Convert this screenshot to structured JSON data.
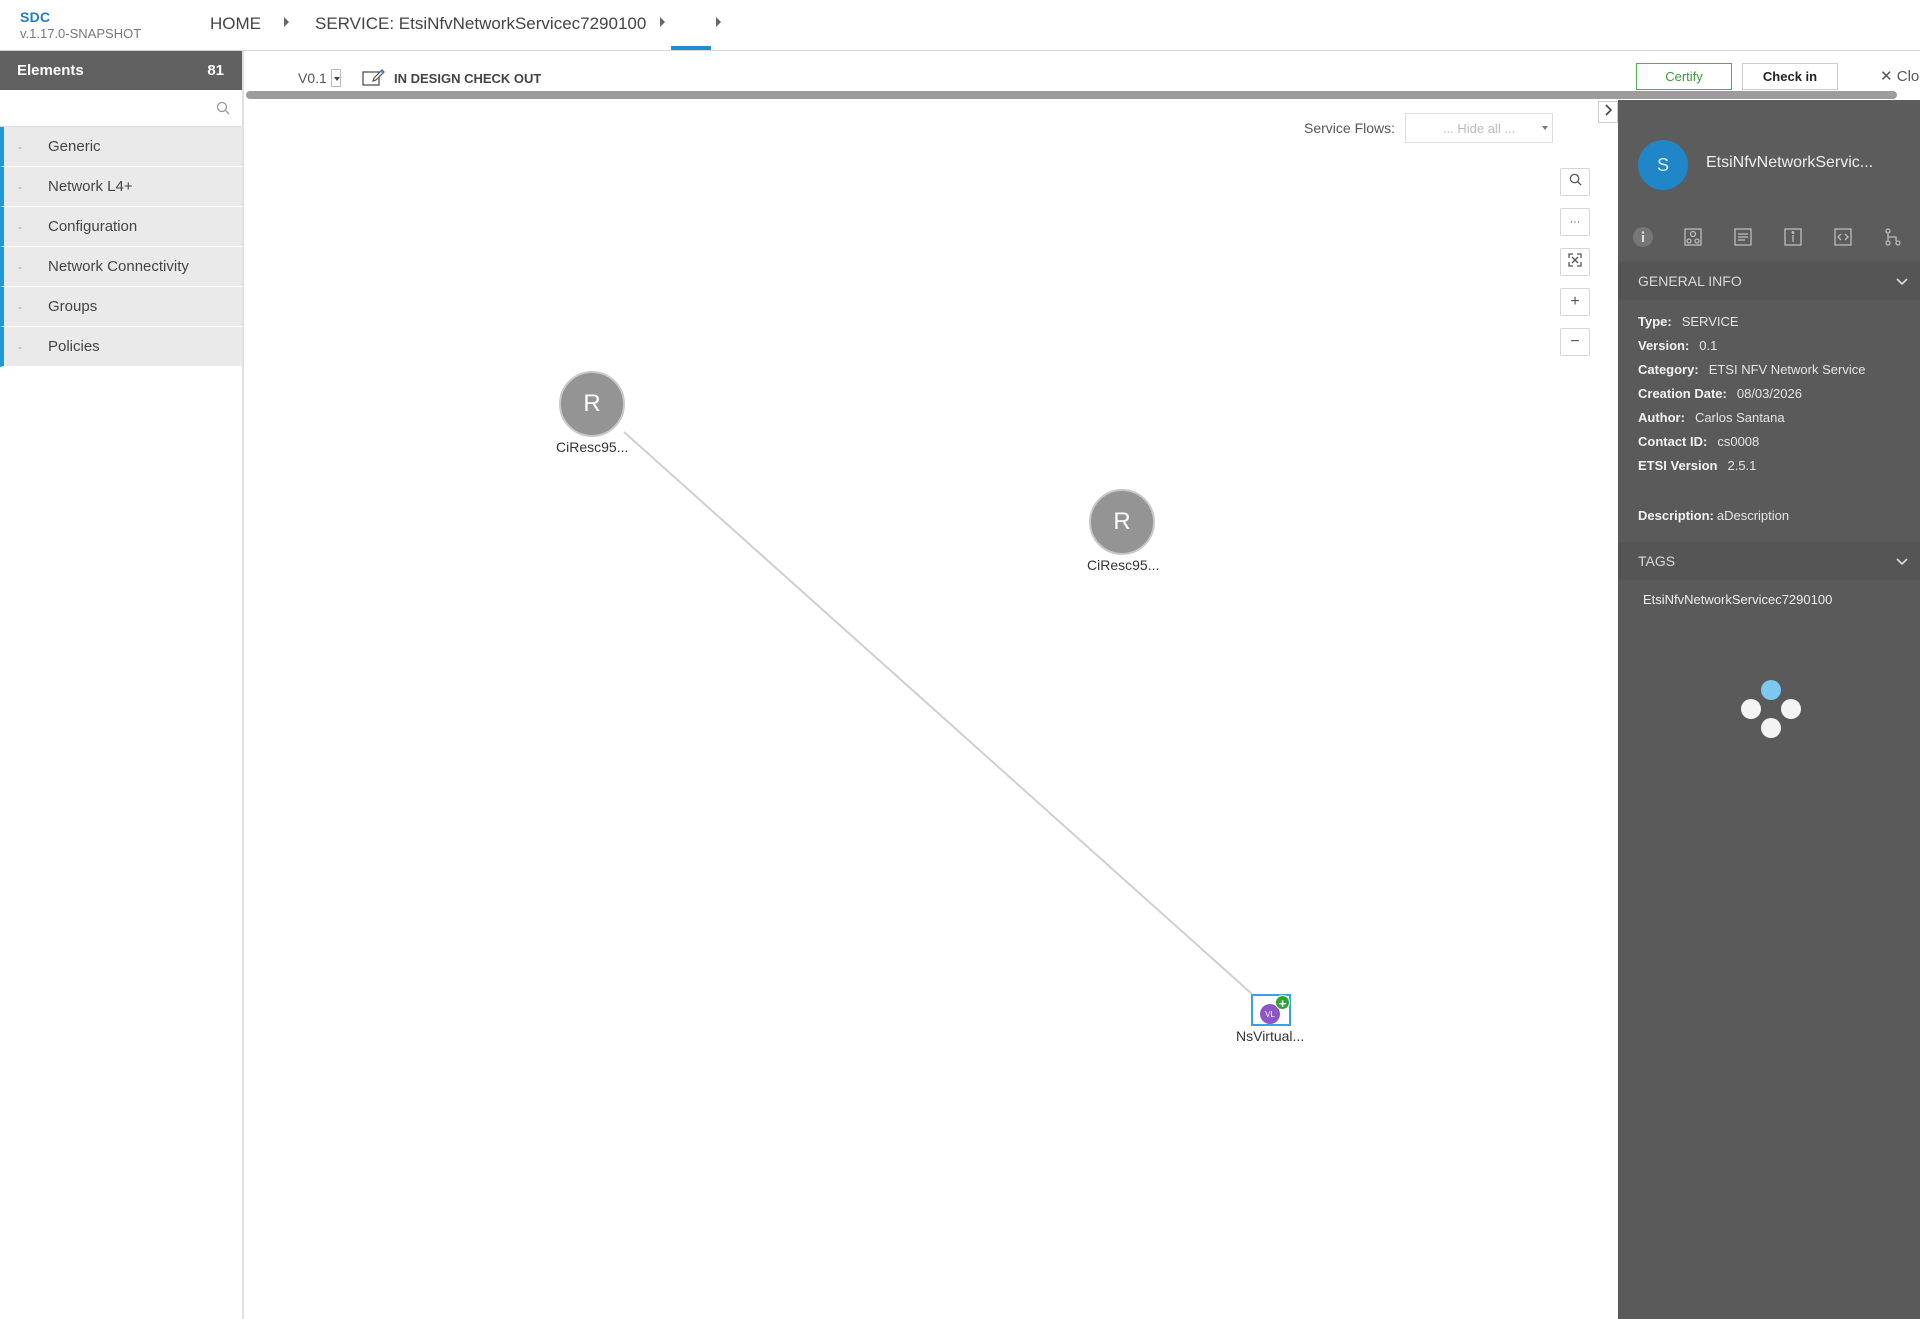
{
  "header": {
    "brand": "SDC",
    "version": "v.1.17.0-SNAPSHOT",
    "breadcrumb": [
      "HOME",
      "SERVICE: EtsiNfvNetworkServicec7290100",
      ""
    ]
  },
  "palette": {
    "title": "Elements",
    "count": "81",
    "search_placeholder": "",
    "categories": [
      {
        "dash": "-",
        "label": "Generic"
      },
      {
        "dash": "-",
        "label": "Network L4+"
      },
      {
        "dash": "-",
        "label": "Configuration"
      },
      {
        "dash": "-",
        "label": "Network Connectivity"
      },
      {
        "dash": "-",
        "label": "Groups"
      },
      {
        "dash": "-",
        "label": "Policies"
      }
    ]
  },
  "toolbar": {
    "version": "V0.1",
    "status": "IN DESIGN CHECK OUT",
    "certify_label": "Certify",
    "checkin_label": "Check in",
    "close_label": "Clo"
  },
  "canvas": {
    "service_flows_label": "Service Flows:",
    "service_flows_value": "... Hide all ...",
    "zoom_controls": {
      "search": "search-icon",
      "more": "···",
      "fit": "fit-icon",
      "zoom_in": "+",
      "zoom_out": "−"
    },
    "nodes": [
      {
        "label": "CiResc95...",
        "letter": "R"
      },
      {
        "label": "CiResc95...",
        "letter": "R"
      },
      {
        "label": "NsVirtual...",
        "letter": "VL"
      }
    ]
  },
  "details": {
    "avatar_letter": "S",
    "title": "EtsiNfvNetworkServic...",
    "general_info_title": "GENERAL INFO",
    "fields": [
      {
        "key": "Type:",
        "value": "SERVICE"
      },
      {
        "key": "Version:",
        "value": "0.1"
      },
      {
        "key": "Category:",
        "value": "ETSI NFV Network Service"
      },
      {
        "key": "Creation Date:",
        "value": "08/03/2026"
      },
      {
        "key": "Author:",
        "value": "Carlos Santana"
      },
      {
        "key": "Contact ID:",
        "value": "cs0008"
      },
      {
        "key": "ETSI Version",
        "value": "2.5.1"
      }
    ],
    "description_key": "Description:",
    "description_value": "aDescription",
    "tags_title": "TAGS",
    "tags": [
      "EtsiNfvNetworkServicec7290100"
    ]
  },
  "colors": {
    "accent": "#1f9ad6",
    "certify": "#3a9a3a",
    "panel": "#5a5a5a",
    "node": "#949494",
    "vl": "#8e56c5"
  }
}
